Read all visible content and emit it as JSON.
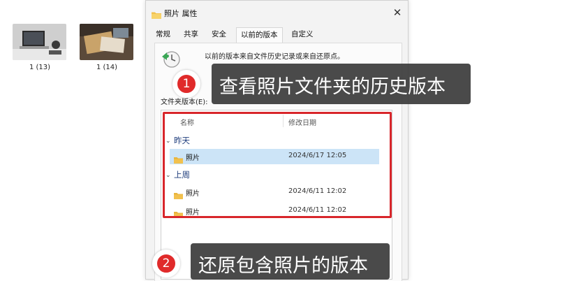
{
  "desktop": {
    "thumbnails": [
      {
        "label": "1 (13)"
      },
      {
        "label": "1 (14)"
      }
    ]
  },
  "dialog": {
    "title": "照片 属性",
    "close_icon": "close-icon",
    "tabs": [
      {
        "label": "常规"
      },
      {
        "label": "共享"
      },
      {
        "label": "安全"
      },
      {
        "label": "以前的版本",
        "active": true
      },
      {
        "label": "自定义"
      }
    ],
    "description": "以前的版本来自文件历史记录或来自还原点。",
    "folder_versions_label": "文件夹版本(E):",
    "columns": {
      "name": "名称",
      "modified": "修改日期"
    },
    "groups": [
      {
        "label": "昨天",
        "items": [
          {
            "name": "照片",
            "date": "2024/6/17 12:05",
            "selected": true
          }
        ]
      },
      {
        "label": "上周",
        "items": [
          {
            "name": "照片",
            "date": "2024/6/11 12:02"
          },
          {
            "name": "照片",
            "date": "2024/6/11 12:02"
          }
        ]
      }
    ]
  },
  "annotations": [
    {
      "number": "1",
      "text": "查看照片文件夹的历史版本"
    },
    {
      "number": "2",
      "text": "还原包含照片的版本"
    }
  ],
  "colors": {
    "highlight": "#d8262b",
    "selection": "#cce4f7",
    "callout_bg": "#3c3c3c",
    "folder": "#f2c14e"
  }
}
